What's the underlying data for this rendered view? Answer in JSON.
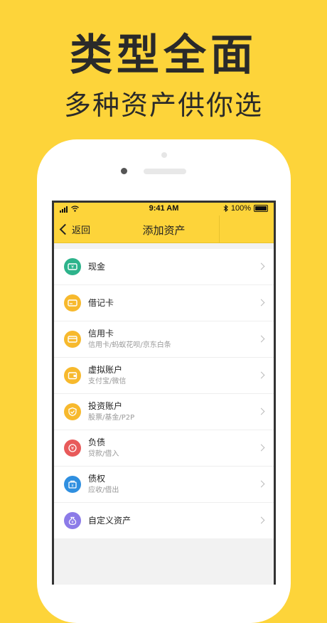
{
  "promo": {
    "headline": "类型全面",
    "subline": "多种资产供你选"
  },
  "statusbar": {
    "time": "9:41 AM",
    "battery": "100%"
  },
  "navbar": {
    "back_label": "返回",
    "title": "添加资产"
  },
  "assets": [
    {
      "label": "现金",
      "sub": "",
      "color": "#2DB38B",
      "icon": "cash-icon"
    },
    {
      "label": "借记卡",
      "sub": "",
      "color": "#F7B92D",
      "icon": "debit-card-icon"
    },
    {
      "label": "信用卡",
      "sub": "信用卡/蚂蚁花呗/京东白条",
      "color": "#F7B92D",
      "icon": "credit-card-icon"
    },
    {
      "label": "虚拟账户",
      "sub": "支付宝/微信",
      "color": "#F7B92D",
      "icon": "wallet-icon"
    },
    {
      "label": "投资账户",
      "sub": "股票/基金/P2P",
      "color": "#F7B92D",
      "icon": "investment-icon"
    },
    {
      "label": "负债",
      "sub": "贷款/借入",
      "color": "#E85A5A",
      "icon": "liability-icon"
    },
    {
      "label": "债权",
      "sub": "应收/借出",
      "color": "#2F8FE0",
      "icon": "receivable-icon"
    },
    {
      "label": "自定义资产",
      "sub": "",
      "color": "#8C7BE8",
      "icon": "custom-asset-icon"
    }
  ]
}
